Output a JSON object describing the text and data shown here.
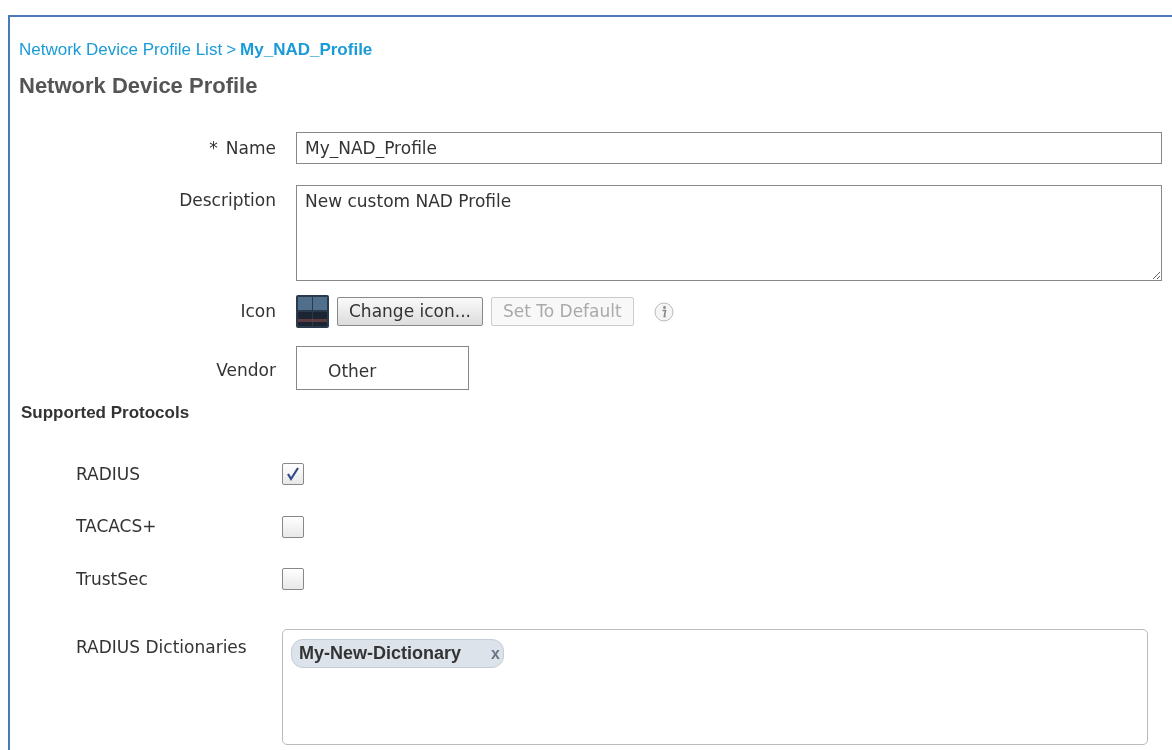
{
  "breadcrumb": {
    "parent": "Network Device Profile List",
    "separator": ">",
    "current": "My_NAD_Profile"
  },
  "title": "Network Device Profile",
  "form": {
    "name": {
      "label": "Name",
      "required_mark": "*",
      "value": "My_NAD_Profile"
    },
    "description": {
      "label": "Description",
      "value": "New custom NAD Profile"
    },
    "icon": {
      "label": "Icon",
      "buttons": [
        {
          "label": "Change icon...",
          "disabled": false
        },
        {
          "label": "Set To Default",
          "disabled": true
        }
      ]
    },
    "vendor": {
      "label": "Vendor",
      "value": "Other"
    }
  },
  "supported_protocols": {
    "heading": "Supported Protocols",
    "protocols": [
      {
        "label": "RADIUS",
        "checked": true
      },
      {
        "label": "TACACS+",
        "checked": false
      },
      {
        "label": "TrustSec",
        "checked": false
      }
    ],
    "radius_dictionaries": {
      "label": "RADIUS Dictionaries",
      "tags": [
        {
          "label": "My-New-Dictionary",
          "remove": "x"
        }
      ]
    }
  }
}
